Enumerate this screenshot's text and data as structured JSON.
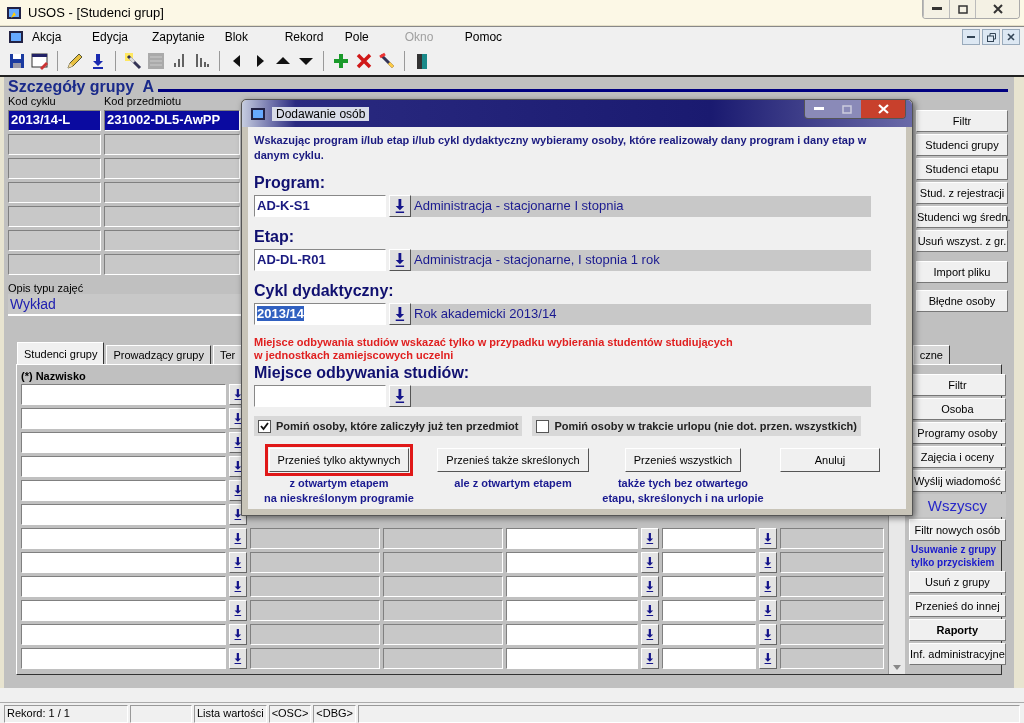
{
  "window": {
    "title": "USOS - [Studenci grup]"
  },
  "menu": [
    {
      "label": "Akcja",
      "disabled": false
    },
    {
      "label": "Edycja",
      "disabled": false
    },
    {
      "label": "Zapytanie",
      "disabled": false
    },
    {
      "label": "Blok",
      "disabled": false
    },
    {
      "label": "Rekord",
      "disabled": false
    },
    {
      "label": "Pole",
      "disabled": false
    },
    {
      "label": "Okno",
      "disabled": true
    },
    {
      "label": "Pomoc",
      "disabled": false
    }
  ],
  "header": {
    "title": "Szczegóły grupy  A",
    "labels": [
      "Kod cyklu",
      "Kod przedmiotu"
    ],
    "values": [
      "2013/14-L",
      "231002-DL5-AwPP"
    ]
  },
  "description": {
    "label": "Opis typu zajęć",
    "value": "Wykład"
  },
  "side_buttons": [
    "Filtr",
    "Studenci grupy",
    "Studenci etapu",
    "Stud. z rejestracji",
    "Studenci wg średn.",
    "Usuń wszyst. z gr.",
    "Import pliku",
    "Błędne osoby"
  ],
  "tabs": [
    {
      "label": "Studenci grupy",
      "selected": true
    },
    {
      "label": "Prowadzący grupy",
      "selected": false
    },
    {
      "label": "Ter",
      "selected": false
    },
    {
      "label": "czne",
      "selected": false
    }
  ],
  "grid": {
    "column_label": "(*) Nazwisko"
  },
  "panel_buttons": [
    {
      "label": "Filtr",
      "kind": "button"
    },
    {
      "label": "Osoba",
      "kind": "button"
    },
    {
      "label": "Programy osoby",
      "kind": "button"
    },
    {
      "label": "Zajęcia i oceny",
      "kind": "button"
    },
    {
      "label": "Wyślij wiadomość",
      "kind": "button"
    },
    {
      "label": "Wszyscy",
      "kind": "caption"
    },
    {
      "label": "Filtr nowych osób",
      "kind": "button"
    },
    {
      "label": "Usuwanie z grupy\ntylko przyciskiem",
      "kind": "note"
    },
    {
      "label": "Usuń z grupy",
      "kind": "button"
    },
    {
      "label": "Przenieś do innej",
      "kind": "button"
    },
    {
      "label": "Raporty",
      "kind": "bold"
    },
    {
      "label": "Inf. administracyjne",
      "kind": "button"
    }
  ],
  "status_bar": [
    "Rekord: 1 / 1",
    "Lista wartości",
    "<OSC>",
    "<DBG>"
  ],
  "dialog": {
    "title": "Dodawanie osób",
    "intro": "Wskazując program i/lub etap i/lub cykl dydaktyczny wybieramy osoby, które realizowały dany program i dany etap w danym cyklu.",
    "fields": [
      {
        "label": "Program:",
        "code": "AD-K-S1",
        "description": "Administracja - stacjonarne I stopnia",
        "selected": false
      },
      {
        "label": "Etap:",
        "code": "AD-DL-R01",
        "description": "Administracja - stacjonarne, I stopnia 1 rok",
        "selected": false
      },
      {
        "label": "Cykl dydaktyczny:",
        "code": "2013/14",
        "description": "Rok akademicki 2013/14",
        "selected": true
      }
    ],
    "warning": "Miejsce odbywania studiów wskazać tylko w przypadku wybierania studentów studiujących\nw jednostkach zamiejscowych uczelni",
    "place": {
      "label": "Miejsce odbywania studiów:"
    },
    "options": [
      {
        "label": "Pomiń osoby, które zaliczyły już ten przedmiot",
        "checked": true
      },
      {
        "label": "Pomiń osoby w trakcie urlopu (nie dot. przen. wszystkich)",
        "checked": false
      }
    ],
    "actions": [
      {
        "label": "Przenieś tylko aktywnych",
        "note": "z otwartym etapem\nna nieskreślonym programie",
        "highlighted": true
      },
      {
        "label": "Przenieś także skreślonych",
        "note": "ale z otwartym etapem",
        "highlighted": false
      },
      {
        "label": "Przenieś wszystkich",
        "note": "także tych bez otwartego\netapu, skreślonych i na urlopie",
        "highlighted": false
      },
      {
        "label": "Anuluj",
        "highlighted": false
      }
    ]
  }
}
